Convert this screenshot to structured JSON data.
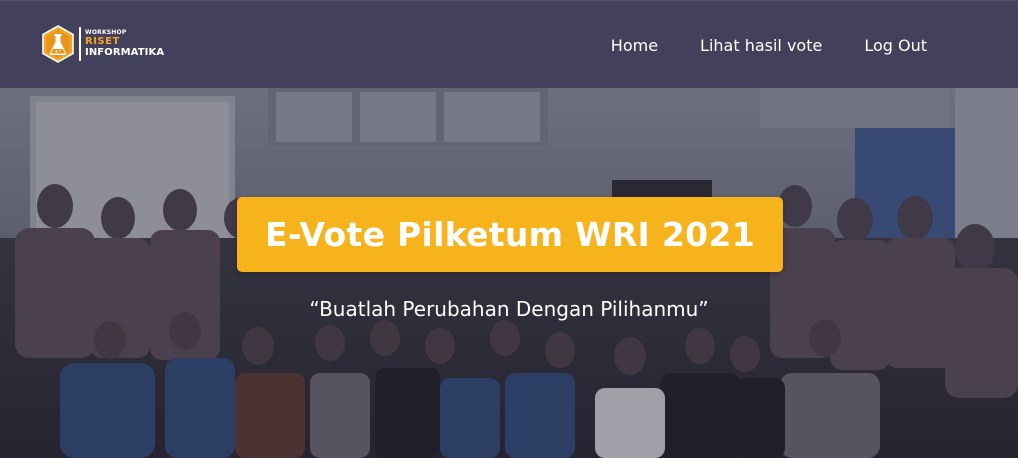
{
  "brand": {
    "small": "WORKSHOP",
    "riset": "RISET",
    "informatika": "INFORMATIKA",
    "icon": "flask-hexagon-logo",
    "accent": "#f4a522"
  },
  "nav": {
    "items": [
      {
        "label": "Home"
      },
      {
        "label": "Lihat hasil vote"
      },
      {
        "label": "Log Out"
      }
    ]
  },
  "hero": {
    "title": "E-Vote Pilketum WRI 2021",
    "tagline": "“Buatlah Perubahan Dengan Pilihanmu”",
    "title_bg": "#f6b31c",
    "navbar_bg": "#43405c"
  }
}
